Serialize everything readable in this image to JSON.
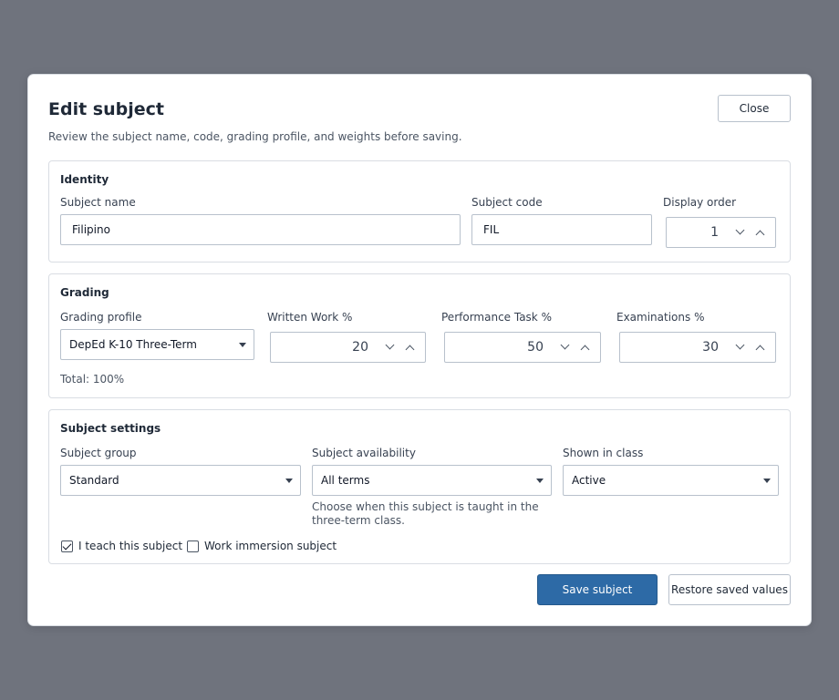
{
  "dialog": {
    "title": "Edit subject",
    "subtitle": "Review the subject name, code, grading profile, and weights before saving.",
    "close_label": "Close"
  },
  "identity": {
    "heading": "Identity",
    "subject_name_label": "Subject name",
    "subject_name_value": "Filipino",
    "subject_code_label": "Subject code",
    "subject_code_value": "FIL",
    "display_order_label": "Display order",
    "display_order_value": "1"
  },
  "grading": {
    "heading": "Grading",
    "profile_label": "Grading profile",
    "profile_value": "DepEd K-10 Three-Term",
    "written_label": "Written Work %",
    "written_value": "20",
    "performance_label": "Performance Task %",
    "performance_value": "50",
    "exams_label": "Examinations %",
    "exams_value": "30",
    "total_text": "Total: 100%"
  },
  "settings": {
    "heading": "Subject settings",
    "group_label": "Subject group",
    "group_value": "Standard",
    "availability_label": "Subject availability",
    "availability_value": "All terms",
    "availability_help": "Choose when this subject is taught in the three-term class.",
    "shown_label": "Shown in class",
    "shown_value": "Active",
    "teach_label": "I teach this subject",
    "teach_checked": true,
    "immersion_label": "Work immersion subject",
    "immersion_checked": false
  },
  "actions": {
    "save_label": "Save subject",
    "restore_label": "Restore saved values"
  },
  "colors": {
    "backdrop": "#6f737d",
    "primary": "#2d6aa6"
  }
}
